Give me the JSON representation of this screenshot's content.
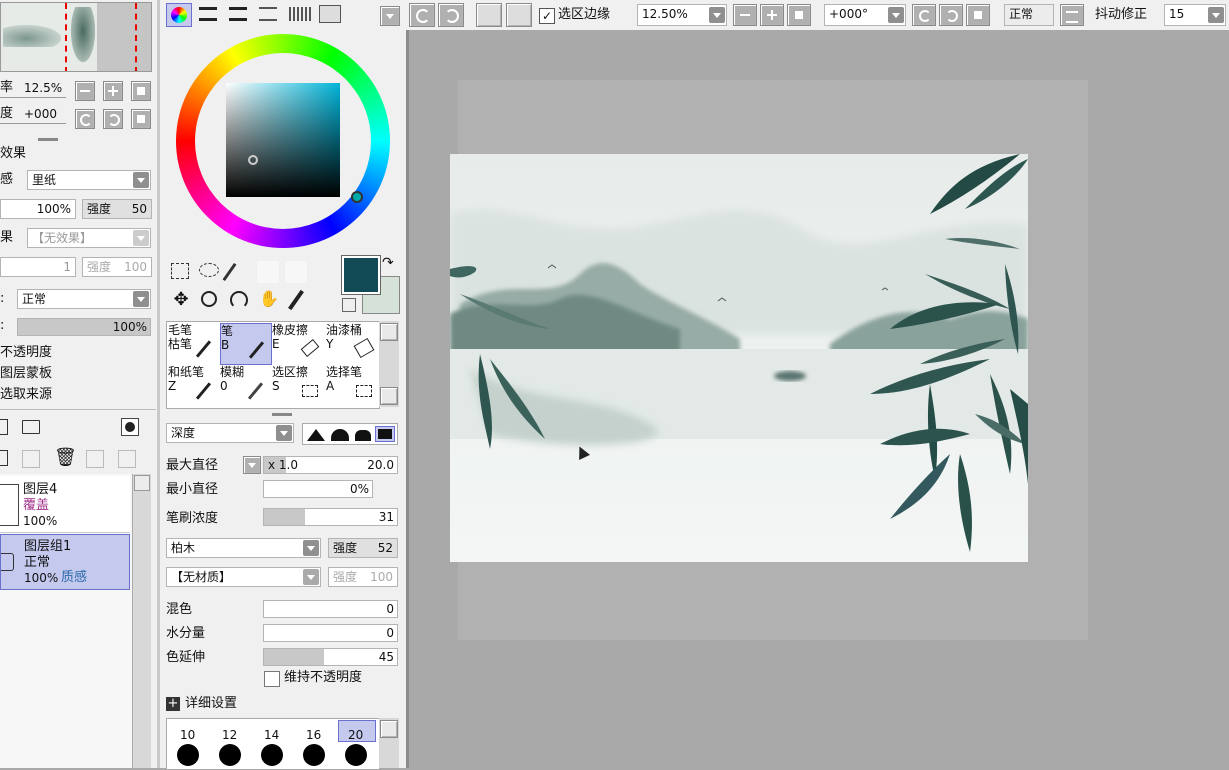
{
  "nav": {
    "zoom_label": "率",
    "zoom_value": "12.5%",
    "rotate_label": "度",
    "rotate_value": "+000"
  },
  "paper": {
    "section_label": "效果",
    "texture_label": "感",
    "texture_value": "里纸",
    "texture_pct": "100%",
    "strength_label": "强度",
    "strength_value": "50",
    "effect_label": "果",
    "effect_value": "【无效果】",
    "effect_num": "1",
    "effect_strength_label": "强度",
    "effect_strength_value": "100"
  },
  "layer_props": {
    "blend_mode": "正常",
    "opacity": "100%",
    "opacity_fraction": 1.0,
    "protect_opacity": "不透明度",
    "clip_group": "图层蒙板",
    "selection_source": "选取来源"
  },
  "layers": [
    {
      "name": "图层4",
      "mode": "覆盖",
      "opacity": "100%"
    },
    {
      "name": "图层组1",
      "mode": "正常",
      "opacity": "100%",
      "extra": "质感"
    }
  ],
  "color": {
    "foreground": "#124a55",
    "background": "#d6e2d8"
  },
  "tools": [
    {
      "line1": "毛笔",
      "line2": "枯笔"
    },
    {
      "line1": "笔",
      "line2": "B"
    },
    {
      "line1": "橡皮擦",
      "line2": "E"
    },
    {
      "line1": "油漆桶",
      "line2": "Y"
    },
    {
      "line1": "和纸笔",
      "line2": "Z"
    },
    {
      "line1": "模糊",
      "line2": "0"
    },
    {
      "line1": "选区擦",
      "line2": "S"
    },
    {
      "line1": "选择笔",
      "line2": "A"
    }
  ],
  "brush": {
    "shape_mode": "深度",
    "max_size_label": "最大直径",
    "max_size_mult": "x 1.0",
    "max_size_value": "20.0",
    "min_size_label": "最小直径",
    "min_size_value": "0%",
    "density_label": "笔刷浓度",
    "density_value": "31",
    "density_fraction": 0.31,
    "texture_value": "柏木",
    "texture_strength_label": "强度",
    "texture_strength_value": "52",
    "material_value": "【无材质】",
    "material_strength_label": "强度",
    "material_strength_value": "100",
    "blend_label": "混色",
    "blend_value": "0",
    "water_label": "水分量",
    "water_value": "0",
    "extend_label": "色延伸",
    "extend_value": "45",
    "extend_fraction": 0.45,
    "keep_opacity": "维持不透明度",
    "advanced": "详细设置",
    "sizes": [
      "10",
      "12",
      "14",
      "16",
      "20"
    ]
  },
  "toolbar": {
    "selection_edge": "选区边缘",
    "zoom": "12.50%",
    "angle": "+000°",
    "blend": "正常",
    "stabilizer_label": "抖动修正",
    "stabilizer_value": "15"
  }
}
